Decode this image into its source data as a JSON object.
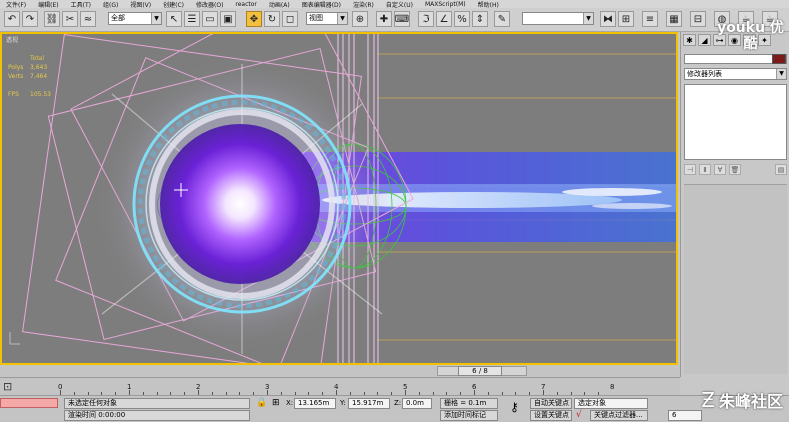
{
  "menu": [
    "文件(F)",
    "编辑(E)",
    "工具(T)",
    "组(G)",
    "视图(V)",
    "创建(C)",
    "修改器(O)",
    "reactor",
    "动画(A)",
    "图表编辑器(D)",
    "渲染(R)",
    "自定义(U)",
    "MAXScript(M)",
    "帮助(H)"
  ],
  "toolbar": {
    "selection_filter": "全部",
    "coord_system": "视图",
    "named_selection": ""
  },
  "viewport": {
    "label": "透视",
    "stats": {
      "header": "Total",
      "polys_label": "Polys",
      "polys_value": "3,643",
      "verts_label": "Verts",
      "verts_value": "7,464",
      "fps_label": "FPS",
      "fps_value": "105.53"
    }
  },
  "command_panel": {
    "modifier_list": "修改器列表"
  },
  "time_slider": {
    "frame_label": "6 / 8"
  },
  "track_bar": {
    "ticks": [
      "0",
      "1",
      "2",
      "3",
      "4",
      "5",
      "6",
      "7",
      "8"
    ]
  },
  "status": {
    "selection_text": "未选定任何对象",
    "prompt_text": "渲染时间 0:00:00",
    "x_label": "X:",
    "x_value": "13.165m",
    "y_label": "Y:",
    "y_value": "15.917m",
    "z_label": "Z:",
    "z_value": "0.0m",
    "grid_label": "栅格 = 0.1m",
    "add_time_tag": "添加时间标记",
    "auto_key": "自动关键点",
    "set_key": "设置关键点",
    "key_mode": "选定对象",
    "key_filters": "关键点过滤器...",
    "frame_value": "6"
  },
  "watermark": {
    "top_text": "youku 优酷",
    "bottom_text": "朱峰社区"
  },
  "colors": {
    "viewport_border": "#f2c200",
    "viewport_bg": "#7d7d7d",
    "stats_text": "#e8c84a",
    "glow_purple": "#9b3cff",
    "ring_cyan": "#7fe6ff",
    "beam_blue": "#3a6cff"
  }
}
